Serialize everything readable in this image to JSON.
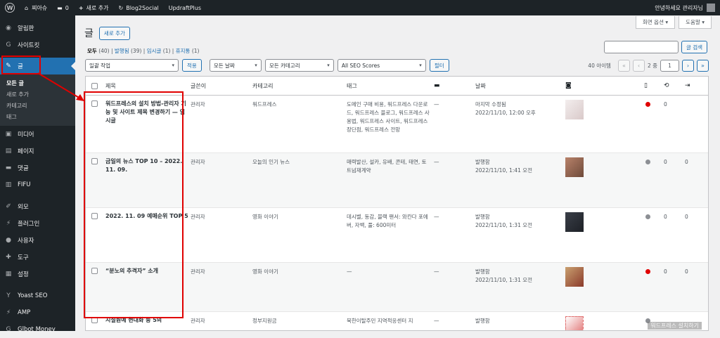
{
  "adminbar": {
    "site_name": "찌아슈",
    "comments_count": "0",
    "new_label": "새로 추가",
    "blog2social": "Blog2Social",
    "updraft": "UpdraftPlus",
    "greeting": "안녕하세요 관리자님"
  },
  "sidebar": {
    "items_top": [
      {
        "label": "알림판",
        "icon": "dashboard-icon",
        "glyph": "◉"
      },
      {
        "label": "사이트킷",
        "icon": "sitekit-icon",
        "glyph": "G"
      }
    ],
    "active": {
      "label": "글",
      "icon": "pin-icon",
      "glyph": "✎"
    },
    "submenu": [
      {
        "label": "모든 글",
        "current": true
      },
      {
        "label": "새로 추가",
        "current": false
      },
      {
        "label": "카테고리",
        "current": false
      },
      {
        "label": "태그",
        "current": false
      }
    ],
    "items_mid": [
      {
        "label": "미디어",
        "icon": "media-icon",
        "glyph": "▣"
      },
      {
        "label": "페이지",
        "icon": "page-icon",
        "glyph": "▤"
      },
      {
        "label": "댓글",
        "icon": "comment-icon",
        "glyph": "▬"
      },
      {
        "label": "FIFU",
        "icon": "fifu-icon",
        "glyph": "▥"
      }
    ],
    "items_low": [
      {
        "label": "외모",
        "icon": "appearance-icon",
        "glyph": "✐"
      },
      {
        "label": "플러그인",
        "icon": "plugin-icon",
        "glyph": "⚡"
      },
      {
        "label": "사용자",
        "icon": "user-icon",
        "glyph": "●"
      },
      {
        "label": "도구",
        "icon": "tool-icon",
        "glyph": "✚"
      },
      {
        "label": "설정",
        "icon": "settings-icon",
        "glyph": "▦"
      }
    ],
    "items_plugins": [
      {
        "label": "Yoast SEO",
        "icon": "yoast-icon",
        "glyph": "Y"
      },
      {
        "label": "AMP",
        "icon": "amp-icon",
        "glyph": "⚡"
      },
      {
        "label": "Glbot Money",
        "icon": "glbot-icon",
        "glyph": "G"
      }
    ]
  },
  "main": {
    "screen_options": "화면 옵션 ▾",
    "help": "도움말 ▾",
    "title": "글",
    "add_new": "새로 추가",
    "filters": {
      "all_label": "모두",
      "all_count": "(40)",
      "published_label": "발행됨",
      "published_count": "(39)",
      "draft_label": "임시글",
      "draft_count": "(1)",
      "trash_label": "휴지통",
      "trash_count": "(1)"
    },
    "search_button": "글 검색",
    "bulk_action": "일괄 작업",
    "apply": "적용",
    "all_dates": "모든 날짜",
    "all_categories": "모든 카테고리",
    "seo_scores": "All SEO Scores",
    "filter_button": "필터",
    "items_count": "40 아이템",
    "page_current": "1",
    "page_total": "2 중"
  },
  "table": {
    "headers": {
      "title": "제목",
      "author": "글쓴이",
      "categories": "카테고리",
      "tags": "태그",
      "date": "날짜"
    },
    "rows": [
      {
        "title": "워드프레스의 설치 방법-관리자 기능 및 사이트 제목 변경하기 — 임시글",
        "author": "관리자",
        "category": "워드프레스",
        "tags": "도메인 구매 비용, 워드프레스 다운로드, 워드프레스 블로그, 워드프레스 사용법, 워드프레스 사이트, 워드프레스 장단점, 워드프레스 전망",
        "comments": "—",
        "status": "마지막 수정됨",
        "date": "2022/11/10, 12:00 오후",
        "seo_color": "#e00000",
        "n1": "0",
        "n2": ""
      },
      {
        "title": "금일의 뉴스 TOP 10 – 2022. 11. 09.",
        "author": "관리자",
        "category": "오늘의 인기 뉴스",
        "tags": "매력발산, 설카, 유배, 콘테, 태연, 토트넘재계약",
        "comments": "—",
        "status": "발행함",
        "date": "2022/11/10, 1:41 오전",
        "seo_color": "#8c8f94",
        "n1": "0",
        "n2": "0"
      },
      {
        "title": "2022. 11. 09 예매순위 TOP 5",
        "author": "관리자",
        "category": "영화 이야기",
        "tags": "데시벨, 동감, 블랙 팬서: 와칸다 포에버, 자백, 풀: 600미터",
        "comments": "—",
        "status": "발행함",
        "date": "2022/11/10, 1:31 오전",
        "seo_color": "#8c8f94",
        "n1": "0",
        "n2": "0"
      },
      {
        "title": "“분노의 추격자” 소개",
        "author": "관리자",
        "category": "영화 이야기",
        "tags": "—",
        "comments": "—",
        "status": "발행함",
        "date": "2022/11/10, 1:31 오전",
        "seo_color": "#e00000",
        "n1": "0",
        "n2": "0"
      },
      {
        "title": "시설원예 현대화 등 5의",
        "author": "관리자",
        "category": "정부지원금",
        "tags": "북한이탈주민 지역적응센터 지",
        "comments": "—",
        "status": "발행함",
        "date": "",
        "seo_color": "#8c8f94",
        "n1": "",
        "n2": ""
      }
    ]
  },
  "colors": {
    "admin_bg": "#1d2327",
    "accent": "#2271b1",
    "annotation_red": "#e00000"
  }
}
